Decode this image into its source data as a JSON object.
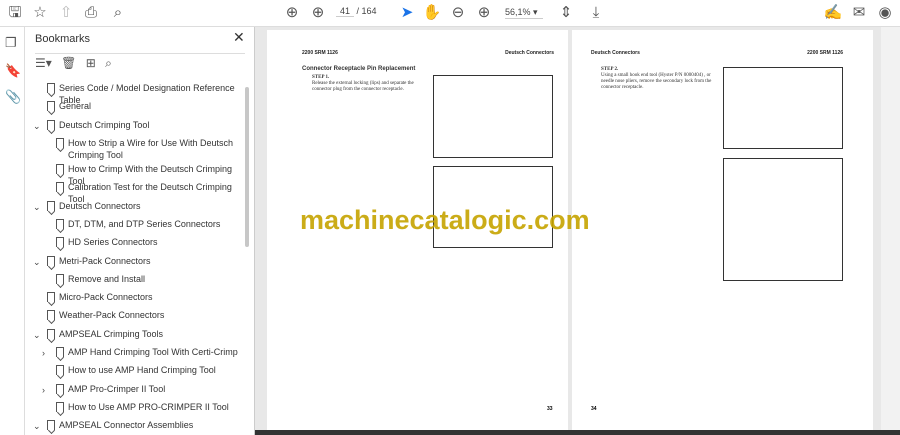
{
  "toolbar": {
    "current_page": "41",
    "total_pages": "/ 164",
    "zoom": "56,1%"
  },
  "bookmarks": {
    "title": "Bookmarks",
    "items": [
      {
        "label": "Series Code / Model Designation Reference Table",
        "level": 0,
        "chev": ""
      },
      {
        "label": "General",
        "level": 0,
        "chev": ""
      },
      {
        "label": "Deutsch Crimping Tool",
        "level": 0,
        "chev": "v"
      },
      {
        "label": "How to Strip a Wire for Use With Deutsch Crimping Tool",
        "level": 1,
        "chev": ""
      },
      {
        "label": "How to Crimp With the Deutsch Crimping Tool",
        "level": 1,
        "chev": ""
      },
      {
        "label": "Calibration Test for the Deutsch Crimping Tool",
        "level": 1,
        "chev": ""
      },
      {
        "label": "Deutsch Connectors",
        "level": 0,
        "chev": "v"
      },
      {
        "label": "DT, DTM, and DTP Series Connectors",
        "level": 1,
        "chev": ""
      },
      {
        "label": "HD Series Connectors",
        "level": 1,
        "chev": ""
      },
      {
        "label": "Metri-Pack Connectors",
        "level": 0,
        "chev": "v"
      },
      {
        "label": "Remove and Install",
        "level": 1,
        "chev": ""
      },
      {
        "label": "Micro-Pack Connectors",
        "level": 0,
        "chev": ""
      },
      {
        "label": "Weather-Pack Connectors",
        "level": 0,
        "chev": ""
      },
      {
        "label": "AMPSEAL Crimping Tools",
        "level": 0,
        "chev": "v"
      },
      {
        "label": "AMP Hand Crimping Tool With Certi-Crimp",
        "level": 1,
        "chev": ">"
      },
      {
        "label": "How to use AMP Hand Crimping Tool",
        "level": 1,
        "chev": ""
      },
      {
        "label": "AMP Pro-Crimper II Tool",
        "level": 1,
        "chev": ">"
      },
      {
        "label": "How to Use AMP PRO-CRIMPER II Tool",
        "level": 1,
        "chev": ""
      },
      {
        "label": "AMPSEAL Connector Assemblies",
        "level": 0,
        "chev": "v"
      }
    ]
  },
  "left_page": {
    "header_left": "2200 SRM 1126",
    "header_right": "Deutsch Connectors",
    "section": "Connector Receptacle Pin Replacement",
    "step": "STEP 1.",
    "text": "Release the external locking (lips) and separate the connector plug from the connector receptacle.",
    "page_number": "33"
  },
  "right_page": {
    "header_left": "Deutsch Connectors",
    "header_right": "2200 SRM 1126",
    "step": "STEP 2.",
    "text": "Using a small hook end tool (Hyster P/N 0000404) , or needle nose pliers, remove the secondary lock from the connector receptacle.",
    "page_number": "34"
  },
  "watermark": "machinecatalogic.com"
}
